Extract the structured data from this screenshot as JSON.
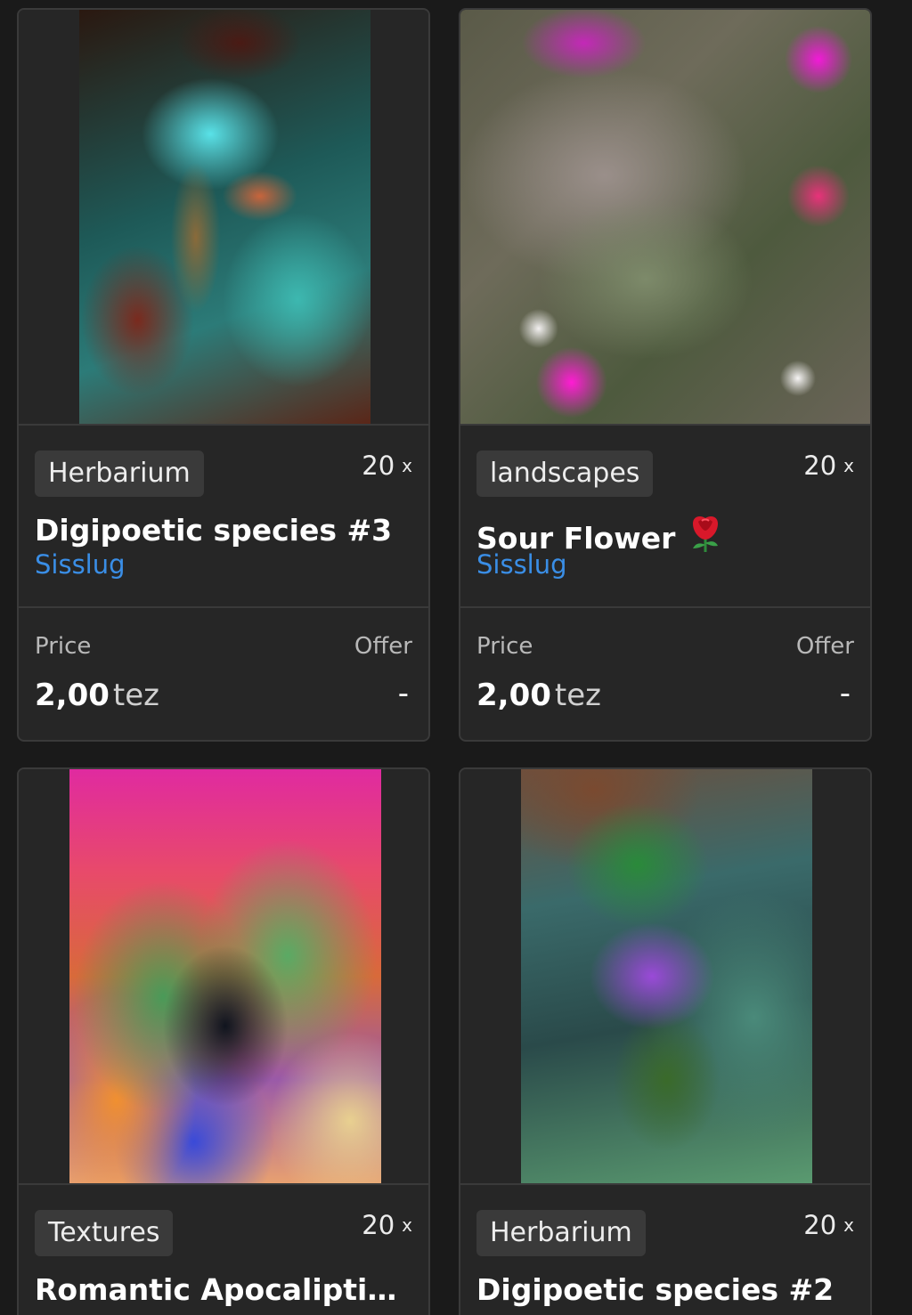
{
  "cards": [
    {
      "image_alt": "Digipoetic species #3 artwork",
      "tag": "Herbarium",
      "editions": "20",
      "editions_suffix": "x",
      "title": "Digipoetic species #3",
      "artist": "Sisslug",
      "price_label": "Price",
      "offer_label": "Offer",
      "price_value": "2,00",
      "price_unit": "tez",
      "offer_value": "-"
    },
    {
      "image_alt": "Sour Flower artwork",
      "tag": "landscapes",
      "editions": "20",
      "editions_suffix": "x",
      "title": "Sour Flower",
      "title_emoji": "rose-icon",
      "artist": "Sisslug",
      "price_label": "Price",
      "offer_label": "Offer",
      "price_value": "2,00",
      "price_unit": "tez",
      "offer_value": "-"
    },
    {
      "image_alt": "Romantic Apocaliptic artwork",
      "tag": "Textures",
      "editions": "20",
      "editions_suffix": "x",
      "title": "Romantic Apocaliptic …"
    },
    {
      "image_alt": "Digipoetic species #2 artwork",
      "tag": "Herbarium",
      "editions": "20",
      "editions_suffix": "x",
      "title": "Digipoetic species #2"
    }
  ],
  "colors": {
    "background": "#1a1a1a",
    "card": "#262626",
    "border": "#3a3a3a",
    "artist_link": "#3a8ee6",
    "rose": "#d8182a"
  }
}
